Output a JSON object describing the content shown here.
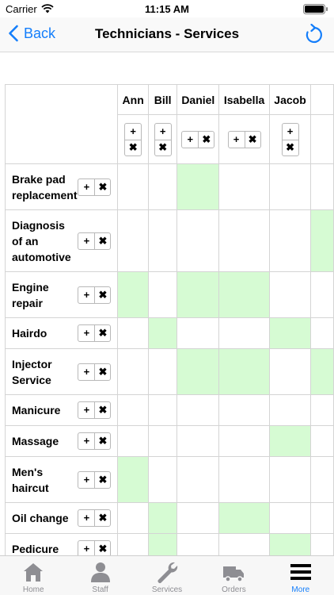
{
  "status": {
    "carrier": "Carrier",
    "time": "11:15 AM"
  },
  "nav": {
    "back_label": "Back",
    "title": "Technicians - Services"
  },
  "technicians": [
    {
      "name": "Ann",
      "buttons": "vertical"
    },
    {
      "name": "Bill",
      "buttons": "vertical"
    },
    {
      "name": "Daniel",
      "buttons": "horizontal"
    },
    {
      "name": "Isabella",
      "buttons": "horizontal"
    },
    {
      "name": "Jacob",
      "buttons": "vertical"
    }
  ],
  "buttons": {
    "add": "+",
    "remove": "✖"
  },
  "services": [
    {
      "name": "Brake pad replacement",
      "assigned": [
        false,
        false,
        true,
        false,
        false,
        false
      ]
    },
    {
      "name": "Diagnosis of an automotive",
      "assigned": [
        false,
        false,
        false,
        false,
        false,
        true
      ]
    },
    {
      "name": "Engine repair",
      "assigned": [
        true,
        false,
        true,
        true,
        false,
        false
      ]
    },
    {
      "name": "Hairdo",
      "assigned": [
        false,
        true,
        false,
        false,
        true,
        false
      ]
    },
    {
      "name": "Injector Service",
      "assigned": [
        false,
        false,
        true,
        true,
        false,
        true
      ]
    },
    {
      "name": "Manicure",
      "assigned": [
        false,
        false,
        false,
        false,
        false,
        false
      ]
    },
    {
      "name": "Massage",
      "assigned": [
        false,
        false,
        false,
        false,
        true,
        false
      ]
    },
    {
      "name": "Men's haircut",
      "assigned": [
        true,
        false,
        false,
        false,
        false,
        false
      ]
    },
    {
      "name": "Oil change",
      "assigned": [
        false,
        true,
        false,
        true,
        false,
        false
      ]
    },
    {
      "name": "Pedicure",
      "assigned": [
        false,
        true,
        false,
        false,
        true,
        false
      ]
    }
  ],
  "tabs": [
    {
      "label": "Home",
      "icon": "home-icon",
      "active": false
    },
    {
      "label": "Staff",
      "icon": "staff-icon",
      "active": false
    },
    {
      "label": "Services",
      "icon": "wrench-icon",
      "active": false
    },
    {
      "label": "Orders",
      "icon": "truck-icon",
      "active": false
    },
    {
      "label": "More",
      "icon": "menu-icon",
      "active": true
    }
  ],
  "colors": {
    "accent": "#147efb",
    "assigned": "#d6fbd3",
    "grid_line": "#d4d4d4",
    "inactive_tab": "#8e8e93"
  }
}
